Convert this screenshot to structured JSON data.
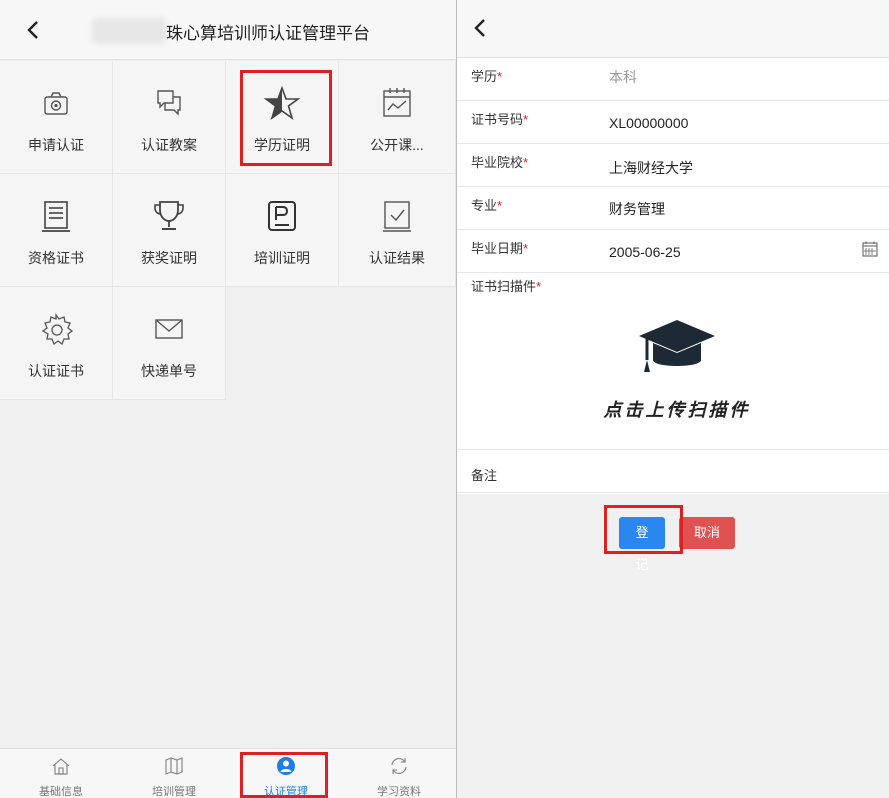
{
  "left": {
    "header": {
      "title": "珠心算培训师认证管理平台"
    },
    "grid": [
      {
        "label": "申请认证",
        "icon": "camera-icon"
      },
      {
        "label": "认证教案",
        "icon": "chat-bubbles-icon"
      },
      {
        "label": "学历证明",
        "icon": "star-icon"
      },
      {
        "label": "公开课...",
        "icon": "calendar-chart-icon"
      },
      {
        "label": "资格证书",
        "icon": "document-list-icon"
      },
      {
        "label": "获奖证明",
        "icon": "trophy-icon"
      },
      {
        "label": "培训证明",
        "icon": "p-badge-icon"
      },
      {
        "label": "认证结果",
        "icon": "checkbox-icon"
      },
      {
        "label": "认证证书",
        "icon": "gear-icon"
      },
      {
        "label": "快递单号",
        "icon": "envelope-icon"
      }
    ],
    "tabs": [
      {
        "label": "基础信息",
        "icon": "home-icon"
      },
      {
        "label": "培训管理",
        "icon": "map-icon"
      },
      {
        "label": "认证管理",
        "icon": "user-circle-icon",
        "active": true
      },
      {
        "label": "学习资料",
        "icon": "refresh-icon"
      }
    ]
  },
  "right": {
    "form": {
      "education": {
        "label": "学历",
        "required": "*",
        "value": "本科"
      },
      "cert_no": {
        "label": "证书号码",
        "required": "*",
        "value": "XL00000000"
      },
      "school": {
        "label": "毕业院校",
        "required": "*",
        "value": "上海财经大学"
      },
      "major": {
        "label": "专业",
        "required": "*",
        "value": "财务管理"
      },
      "grad_date": {
        "label": "毕业日期",
        "required": "*",
        "value": "2005-06-25"
      },
      "scan": {
        "label": "证书扫描件",
        "required": "*",
        "upload_text": "点击上传扫描件"
      },
      "remark": {
        "label": "备注",
        "value": ""
      }
    },
    "buttons": {
      "submit": "登记",
      "cancel": "取消"
    }
  },
  "colors": {
    "primary": "#2a86f0",
    "danger": "#e05252",
    "highlight": "#e02020",
    "active_tab": "#1f7ce8"
  }
}
